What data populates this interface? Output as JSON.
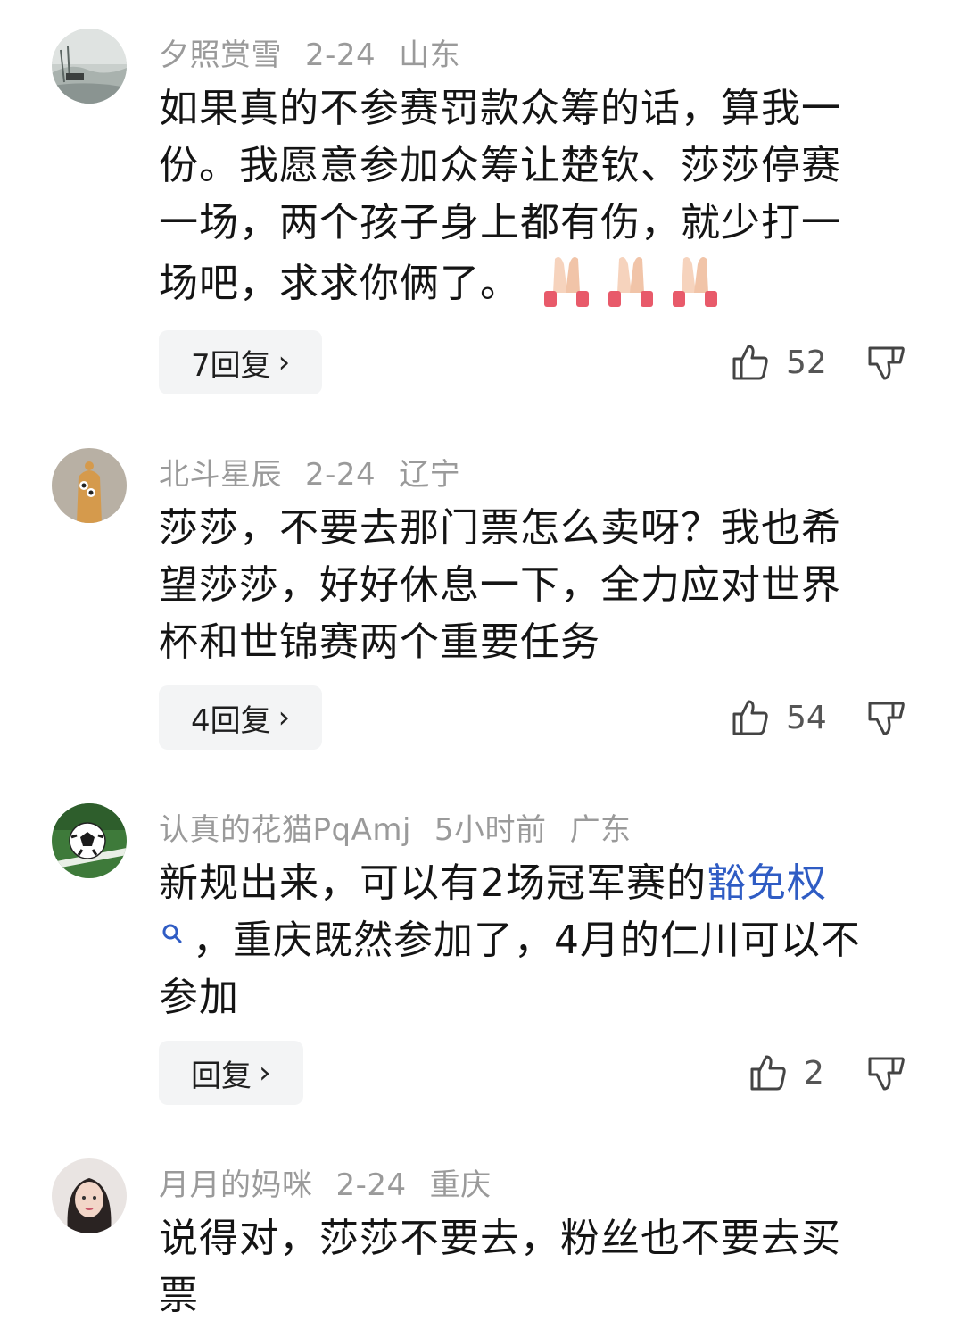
{
  "comments": [
    {
      "user": "夕照赏雪",
      "date": "2-24",
      "location": "山东",
      "text_lines": [
        "如果真的不参赛罚款众筹的话，算我一",
        "份。我愿意参加众筹让楚钦、莎莎停赛",
        "一场，两个孩子身上都有伤，就少打一",
        "场吧，求求你俩了。"
      ],
      "emoji": "folded-hands x3",
      "reply_label": "7回复",
      "likes": "52"
    },
    {
      "user": "北斗星辰",
      "date": "2-24",
      "location": "辽宁",
      "text_lines": [
        "莎莎，不要去那门票怎么卖呀？我也希",
        "望莎莎，好好休息一下，全力应对世界",
        "杯和世锦赛两个重要任务"
      ],
      "reply_label": "4回复",
      "likes": "54"
    },
    {
      "user": "认真的花猫PqAmj",
      "date": "5小时前",
      "location": "广东",
      "text_line1_prefix": "新规出来，可以有2场冠军赛的",
      "text_line1_link": "豁免权",
      "text_line2": "，重庆既然参加了，4月的仁川可以不",
      "text_line3": "参加",
      "reply_label": "回复",
      "likes": "2"
    },
    {
      "user": "月月的妈咪",
      "date": "2-24",
      "location": "重庆",
      "text_lines": [
        "说得对，莎莎不要去，粉丝也不要去买",
        "票"
      ]
    }
  ],
  "icons": {
    "like": "thumbs-up-icon",
    "dislike": "thumbs-down-icon",
    "reply_arrow": "chevron-right-icon",
    "search": "search-icon"
  },
  "colors": {
    "meta_gray": "#9a9a9a",
    "link_blue": "#2f5cc4",
    "button_bg": "#f3f4f5"
  }
}
